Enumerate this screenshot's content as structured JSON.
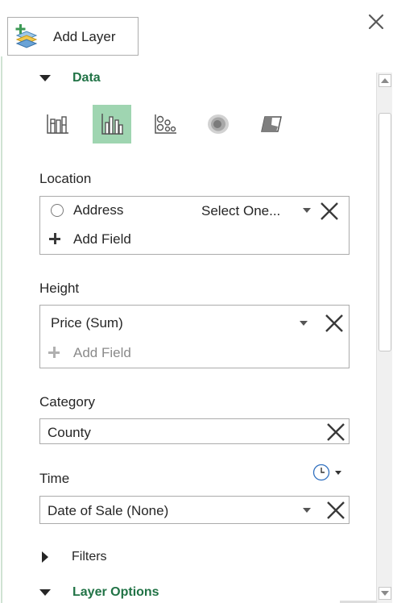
{
  "toolbar": {
    "add_layer_label": "Add Layer"
  },
  "sections": {
    "data_title": "Data",
    "filters_title": "Filters",
    "layer_options_title": "Layer Options"
  },
  "viz_types": [
    {
      "icon": "stacked-column-icon",
      "selected": false
    },
    {
      "icon": "clustered-column-icon",
      "selected": true
    },
    {
      "icon": "bubble-icon",
      "selected": false
    },
    {
      "icon": "heat-map-icon",
      "selected": false
    },
    {
      "icon": "region-icon",
      "selected": false
    }
  ],
  "location": {
    "label": "Location",
    "field_name": "Address",
    "field_type": "Select One...",
    "add_field": "Add Field"
  },
  "height": {
    "label": "Height",
    "field_value": "Price (Sum)",
    "add_field": "Add Field"
  },
  "category": {
    "label": "Category",
    "field_value": "County"
  },
  "time": {
    "label": "Time",
    "field_value": "Date of Sale (None)"
  },
  "colors": {
    "accent": "#217346",
    "selected_bg": "#9fd5b1",
    "border": "#ababab"
  }
}
